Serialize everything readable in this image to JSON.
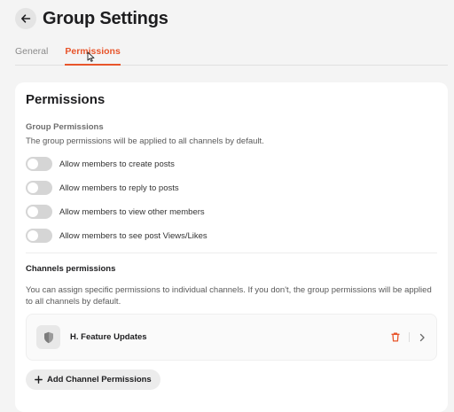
{
  "header": {
    "title": "Group Settings"
  },
  "tabs": [
    {
      "label": "General",
      "active": false
    },
    {
      "label": "Permissions",
      "active": true
    }
  ],
  "card": {
    "title": "Permissions",
    "group": {
      "title": "Group Permissions",
      "description": "The group permissions will be applied to all channels by default.",
      "toggles": [
        {
          "label": "Allow members to create posts",
          "enabled": false
        },
        {
          "label": "Allow members to reply to posts",
          "enabled": false
        },
        {
          "label": "Allow members to view other members",
          "enabled": false
        },
        {
          "label": "Allow members to see post Views/Likes",
          "enabled": false
        }
      ]
    },
    "channels": {
      "title": "Channels permissions",
      "description": "You can assign specific permissions to individual channels. If you don't, the group permissions will be applied to all channels by default.",
      "items": [
        {
          "name": "H. Feature Updates",
          "icon": "shield-icon"
        }
      ],
      "add_label": "Add Channel Permissions"
    }
  },
  "colors": {
    "accent": "#e8552b",
    "background": "#f4f4f4",
    "card": "#ffffff",
    "toggle_off": "#d5d5d5"
  }
}
